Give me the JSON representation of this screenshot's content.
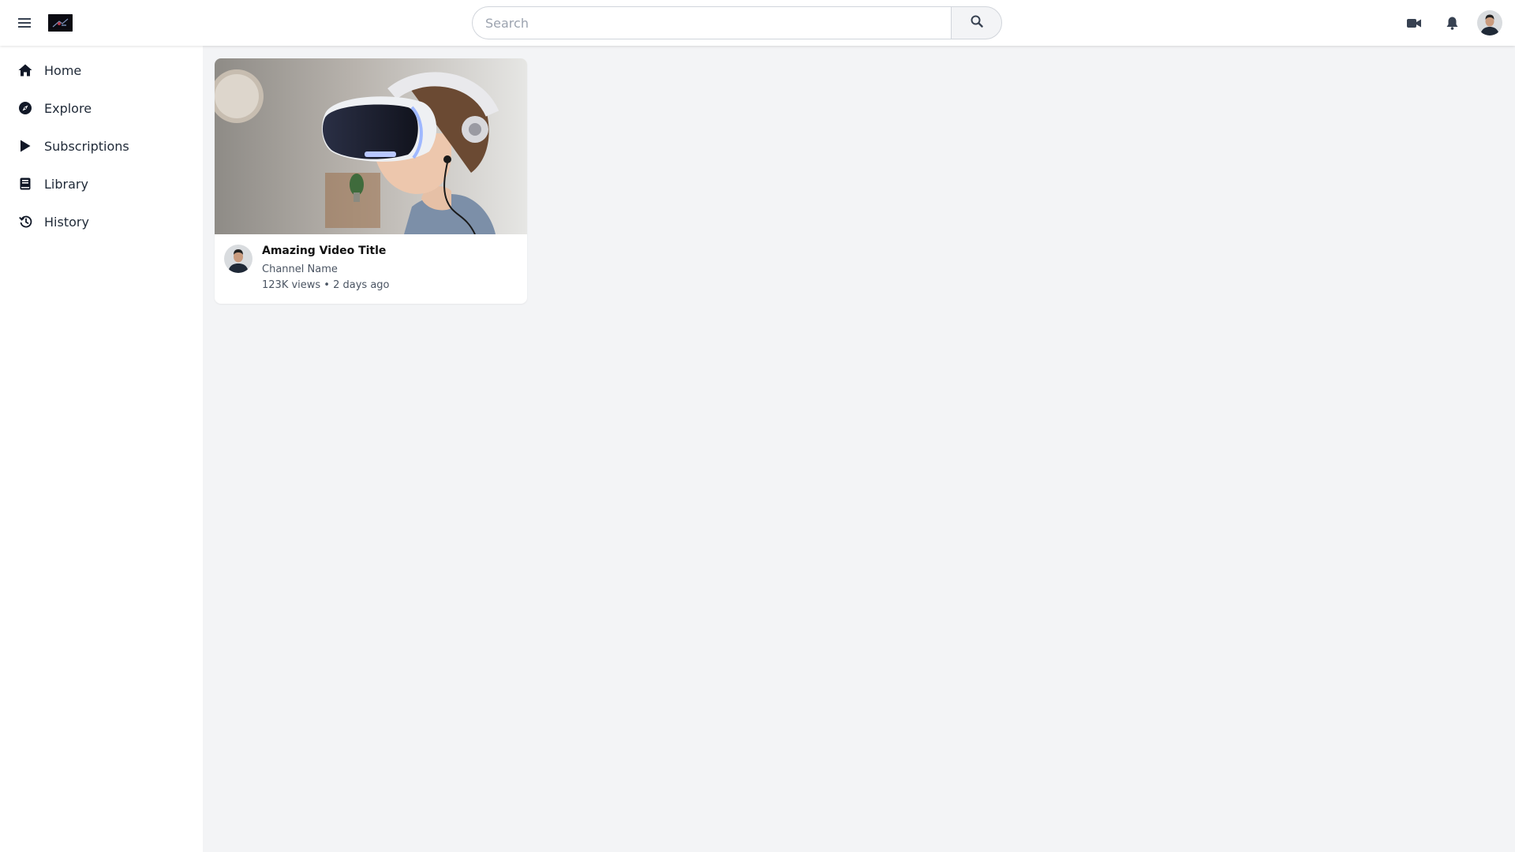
{
  "header": {
    "search_placeholder": "Search",
    "search_value": ""
  },
  "sidebar": {
    "items": [
      {
        "label": "Home",
        "icon": "home-icon"
      },
      {
        "label": "Explore",
        "icon": "compass-icon"
      },
      {
        "label": "Subscriptions",
        "icon": "play-icon"
      },
      {
        "label": "Library",
        "icon": "book-icon"
      },
      {
        "label": "History",
        "icon": "history-icon"
      }
    ]
  },
  "videos": [
    {
      "title": "Amazing Video Title",
      "channel": "Channel Name",
      "meta": "123K views • 2 days ago"
    }
  ],
  "colors": {
    "background": "#f3f4f6",
    "surface": "#ffffff",
    "icon": "#374151"
  }
}
